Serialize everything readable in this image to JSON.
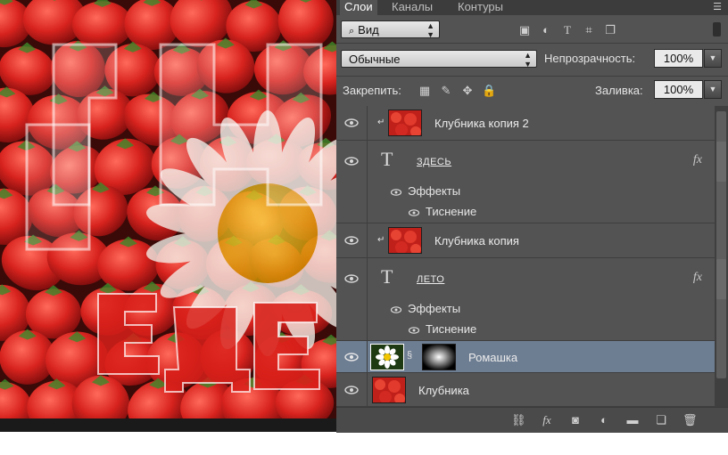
{
  "tabs": [
    {
      "label": "Слои",
      "active": true
    },
    {
      "label": "Каналы",
      "active": false
    },
    {
      "label": "Контуры",
      "active": false
    }
  ],
  "filter": {
    "search_icon": "search-icon",
    "kind_label": "Вид",
    "filter_icons": [
      "image-filter-icon",
      "adjustment-filter-icon",
      "type-filter-icon",
      "shape-filter-icon",
      "smart-object-filter-icon"
    ]
  },
  "blend": {
    "mode": "Обычные",
    "opacity_label": "Непрозрачность:",
    "opacity_value": "100%"
  },
  "lock": {
    "label": "Закрепить:",
    "icons": [
      "lock-transparent-icon",
      "lock-image-icon",
      "lock-position-icon",
      "lock-all-icon"
    ],
    "fill_label": "Заливка:",
    "fill_value": "100%"
  },
  "layers": [
    {
      "name": "Клубника копия 2",
      "type": "image",
      "clipped": true
    },
    {
      "name": "ЗДЕСЬ",
      "type": "text",
      "fx": "fx",
      "effects_label": "Эффекты",
      "effect": "Тиснение"
    },
    {
      "name": "Клубника копия",
      "type": "image",
      "clipped": true
    },
    {
      "name": "ЛЕТО",
      "type": "text",
      "fx": "fx",
      "effects_label": "Эффекты",
      "effect": "Тиснение"
    },
    {
      "name": "Ромашка",
      "type": "image-mask",
      "selected": true
    },
    {
      "name": "Клубника",
      "type": "image"
    }
  ],
  "bottom_icons": [
    "link-layers-icon",
    "fx-icon",
    "add-mask-icon",
    "adjustment-layer-icon",
    "new-group-icon",
    "new-layer-icon",
    "trash-icon"
  ],
  "colors": {
    "panel": "#535353",
    "selected": "#6d7d92",
    "tabbar": "#3c3c3c"
  }
}
